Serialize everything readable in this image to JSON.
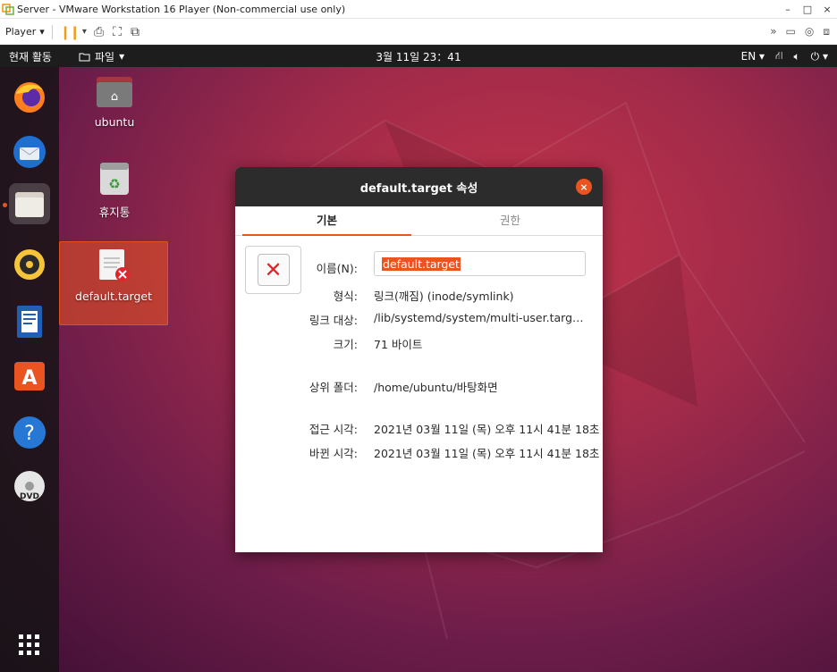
{
  "vm_window": {
    "title": "Server - VMware Workstation 16 Player (Non-commercial use only)",
    "minimize": "–",
    "maximize": "□",
    "close": "×"
  },
  "vm_toolbar": {
    "player_label": "Player",
    "player_caret": "▾"
  },
  "topbar": {
    "activities": "현재 활동",
    "files_menu": "파일",
    "clock": "3월 11일  23：41",
    "language": "EN"
  },
  "desktop_icons": [
    {
      "label": "ubuntu"
    },
    {
      "label": "휴지통"
    },
    {
      "label": "default.target"
    }
  ],
  "dock": {
    "items": [
      "Firefox",
      "Thunderbird",
      "Files",
      "Rhythmbox",
      "LibreOffice Writer",
      "Ubuntu Software",
      "Help",
      "DVD"
    ],
    "active": "Files"
  },
  "dialog": {
    "title": "default.target 속성",
    "close_glyph": "×",
    "tabs": [
      {
        "label": "기본",
        "active": true
      },
      {
        "label": "권한",
        "active": false
      }
    ],
    "name_label": "이름(N):",
    "name_value": "default.target",
    "type_label": "형식:",
    "type_value": "링크(깨짐) (inode/symlink)",
    "link_target_label": "링크 대상:",
    "link_target_value": "/lib/systemd/system/multi-user.targ…",
    "size_label": "크기:",
    "size_value": "71 바이트",
    "parent_label": "상위 폴더:",
    "parent_value": "/home/ubuntu/바탕화면",
    "accessed_label": "접근 시각:",
    "accessed_value": "2021년 03월 11일 (목) 오후 11시 41분 18초",
    "modified_label": "바뀐 시각:",
    "modified_value": "2021년 03월 11일 (목) 오후 11시 41분 18초"
  },
  "colors": {
    "accent": "#e95420",
    "topbar": "#1d1d1d",
    "dialog_header": "#2c2c2c"
  }
}
